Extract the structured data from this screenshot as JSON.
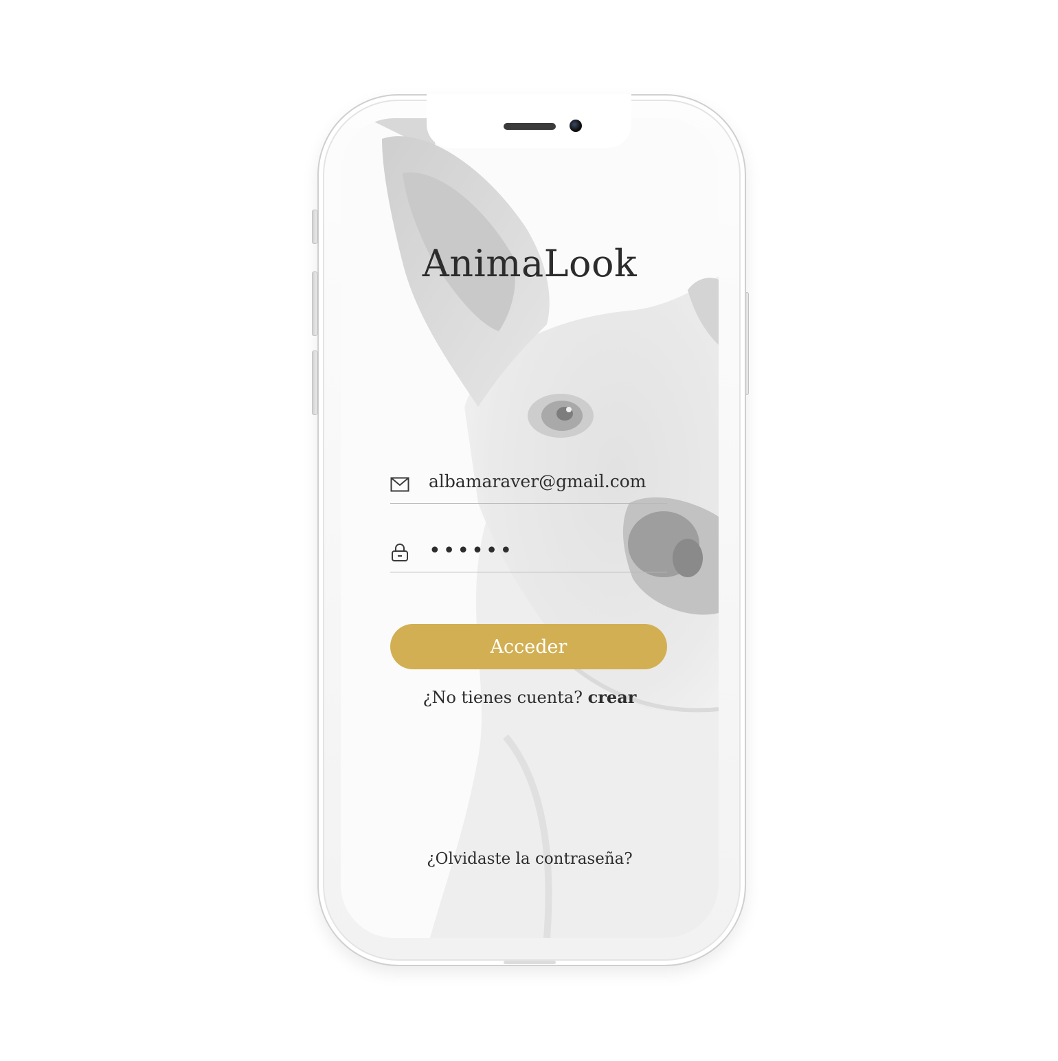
{
  "app": {
    "logo_text": "AnimaLook"
  },
  "login": {
    "email": {
      "icon": "mail-icon",
      "value": "albamaraver@gmail.com"
    },
    "password": {
      "icon": "lock-icon",
      "value": "••••••"
    },
    "submit_label": "Acceder",
    "signup_prompt": "¿No tienes cuenta?",
    "signup_link": "crear",
    "forgot_link": "¿Olvidaste la contraseña?"
  },
  "colors": {
    "accent": "#d2af52",
    "text": "#2d2d2d",
    "background": "#fbfbfb"
  }
}
